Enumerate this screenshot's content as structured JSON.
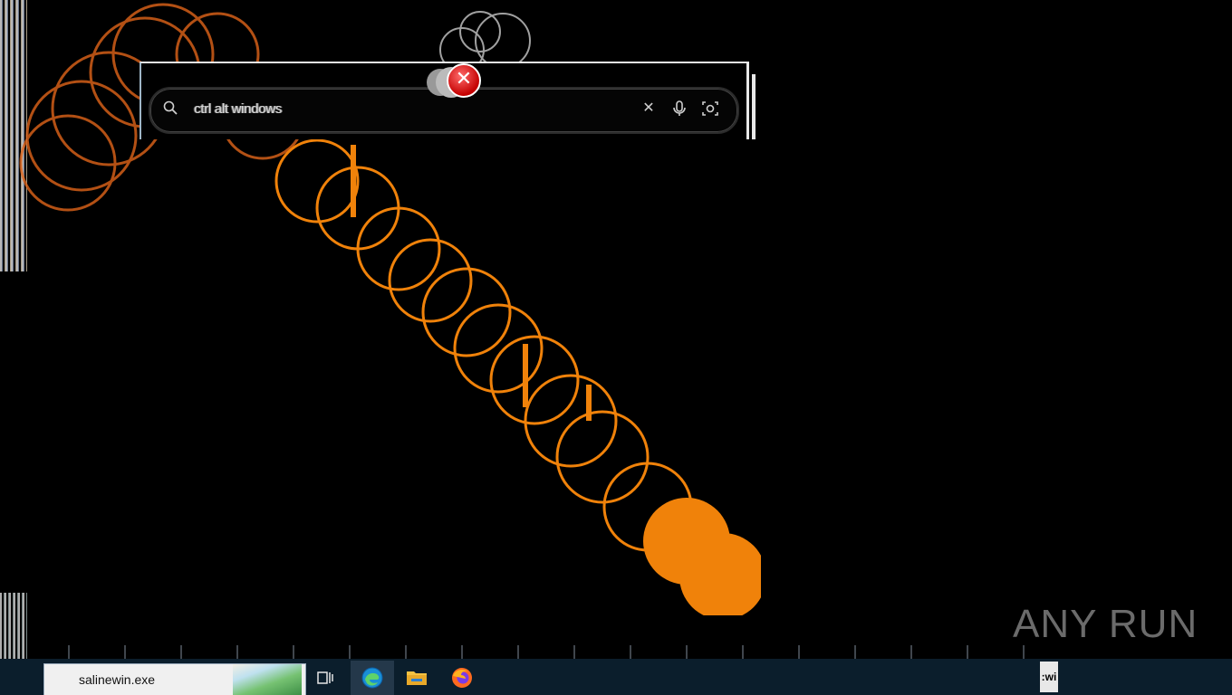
{
  "search_bar": {
    "query": "ctrl alt windows",
    "clear_icon": "close-icon",
    "mic_icon": "microphone-icon",
    "lens_icon": "lens-icon"
  },
  "error_dialog_icon": "error-icon",
  "watermark": {
    "text": "ANY RUN"
  },
  "taskbar": {
    "search_text": "salinewin.exe",
    "apps": [
      {
        "name": "Task View",
        "icon": "task-view-icon"
      },
      {
        "name": "Microsoft Edge",
        "icon": "edge-icon"
      },
      {
        "name": "File Explorer",
        "icon": "folder-icon"
      },
      {
        "name": "Firefox",
        "icon": "firefox-icon"
      }
    ],
    "clipped_label": ":wi"
  },
  "colors": {
    "accent_orange": "#f0820a",
    "desktop": "#000000",
    "taskbar": "#0b1e2c"
  }
}
